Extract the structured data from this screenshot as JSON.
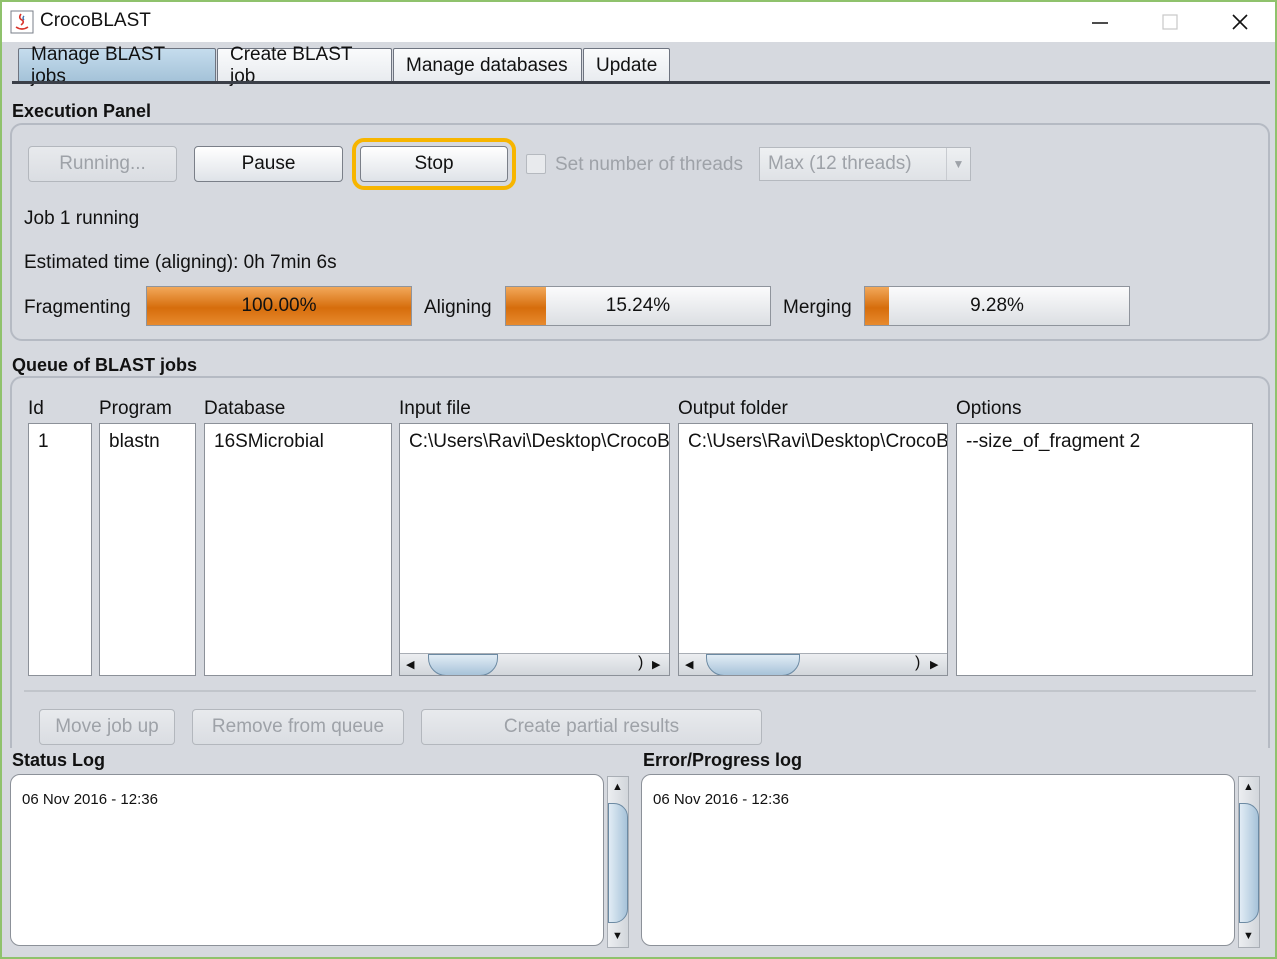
{
  "window": {
    "title": "CrocoBLAST"
  },
  "tabs": [
    {
      "label": "Manage BLAST jobs",
      "active": true
    },
    {
      "label": "Create BLAST job",
      "active": false
    },
    {
      "label": "Manage databases",
      "active": false
    },
    {
      "label": "Update",
      "active": false
    }
  ],
  "execution_panel": {
    "title": "Execution Panel",
    "running_label": "Running...",
    "pause_label": "Pause",
    "stop_label": "Stop",
    "threads_checkbox_label": "Set number of threads",
    "threads_checked": false,
    "threads_select_value": "Max (12 threads)",
    "status_text": "Job 1 running",
    "estimated_time_text": "Estimated time (aligning): 0h 7min 6s",
    "progress": [
      {
        "label": "Fragmenting",
        "value_text": "100.00%",
        "percent": 100.0
      },
      {
        "label": "Aligning",
        "value_text": "15.24%",
        "percent": 15.24
      },
      {
        "label": "Merging",
        "value_text": "9.28%",
        "percent": 9.28
      }
    ],
    "accent_color": "#d66d0c",
    "highlight_color": "#f7b500"
  },
  "queue": {
    "title": "Queue of BLAST jobs",
    "columns": [
      "Id",
      "Program",
      "Database",
      "Input file",
      "Output folder",
      "Options"
    ],
    "rows": [
      {
        "id": "1",
        "program": "blastn",
        "database": "16SMicrobial",
        "input_file": "C:\\Users\\Ravi\\Desktop\\CrocoB",
        "output_folder": "C:\\Users\\Ravi\\Desktop\\CrocoB",
        "options": "--size_of_fragment 2"
      }
    ],
    "move_up_label": "Move job up",
    "remove_label": "Remove from queue",
    "partial_results_label": "Create partial results"
  },
  "status_log": {
    "title": "Status Log",
    "text": "06 Nov 2016 - 12:36"
  },
  "error_log": {
    "title": "Error/Progress log",
    "text": "06 Nov 2016 - 12:36"
  }
}
